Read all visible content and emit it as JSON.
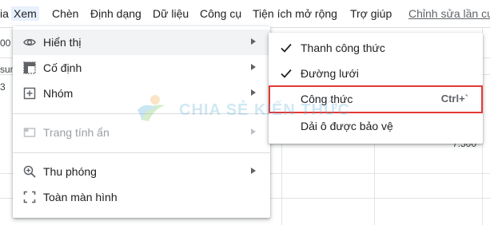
{
  "menubar": {
    "items": [
      {
        "label": "ia"
      },
      {
        "label": "Xem"
      },
      {
        "label": "Chèn"
      },
      {
        "label": "Định dạng"
      },
      {
        "label": "Dữ liệu"
      },
      {
        "label": "Công cụ"
      },
      {
        "label": "Tiện ích mở rộng"
      },
      {
        "label": "Trợ giúp"
      }
    ],
    "edit_link": "Chỉnh sửa lần cuối"
  },
  "sheet": {
    "fragment_1": "00",
    "fragment_2": "sum",
    "fragment_3": "3",
    "fragment_4": "3",
    "fragment_5": "7.500"
  },
  "view_menu": {
    "items": [
      {
        "label": "Hiển thị",
        "icon": "eye-icon"
      },
      {
        "label": "Cố định",
        "icon": "freeze-icon"
      },
      {
        "label": "Nhóm",
        "icon": "group-icon"
      },
      {
        "label": "Trang tính ẩn",
        "icon": "sheet-icon"
      },
      {
        "label": "Thu phóng",
        "icon": "zoom-icon"
      },
      {
        "label": "Toàn màn hình",
        "icon": "fullscreen-icon"
      }
    ]
  },
  "show_submenu": {
    "items": [
      {
        "label": "Thanh công thức",
        "checked": true,
        "shortcut": ""
      },
      {
        "label": "Đường lưới",
        "checked": true,
        "shortcut": ""
      },
      {
        "label": "Công thức",
        "checked": false,
        "shortcut": "Ctrl+`"
      },
      {
        "label": "Dải ô được bảo vệ",
        "checked": false,
        "shortcut": ""
      }
    ]
  },
  "watermark": {
    "text": "CHIA SẺ KIẾN THỨC"
  },
  "colors": {
    "highlight_box": "#e53935",
    "active_menu": "#e8f0fe"
  }
}
